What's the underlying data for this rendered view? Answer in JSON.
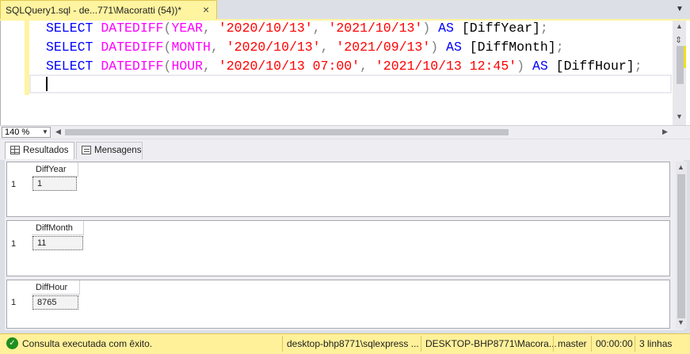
{
  "document_tab": {
    "title": "SQLQuery1.sql - de...771\\Macoratti (54))*",
    "close_glyph": "×"
  },
  "editor": {
    "lines": [
      [
        {
          "t": "SELECT ",
          "c": "kw"
        },
        {
          "t": "DATEDIFF",
          "c": "fn"
        },
        {
          "t": "(",
          "c": "gray"
        },
        {
          "t": "YEAR",
          "c": "fn"
        },
        {
          "t": ", ",
          "c": "gray"
        },
        {
          "t": "'2020/10/13'",
          "c": "str"
        },
        {
          "t": ", ",
          "c": "gray"
        },
        {
          "t": "'2021/10/13'",
          "c": "str"
        },
        {
          "t": ") ",
          "c": "gray"
        },
        {
          "t": "AS ",
          "c": "kw"
        },
        {
          "t": "[DiffYear]",
          "c": "plain"
        },
        {
          "t": ";",
          "c": "gray"
        }
      ],
      [
        {
          "t": "SELECT ",
          "c": "kw"
        },
        {
          "t": "DATEDIFF",
          "c": "fn"
        },
        {
          "t": "(",
          "c": "gray"
        },
        {
          "t": "MONTH",
          "c": "fn"
        },
        {
          "t": ", ",
          "c": "gray"
        },
        {
          "t": "'2020/10/13'",
          "c": "str"
        },
        {
          "t": ", ",
          "c": "gray"
        },
        {
          "t": "'2021/09/13'",
          "c": "str"
        },
        {
          "t": ") ",
          "c": "gray"
        },
        {
          "t": "AS ",
          "c": "kw"
        },
        {
          "t": "[DiffMonth]",
          "c": "plain"
        },
        {
          "t": ";",
          "c": "gray"
        }
      ],
      [
        {
          "t": "SELECT ",
          "c": "kw"
        },
        {
          "t": "DATEDIFF",
          "c": "fn"
        },
        {
          "t": "(",
          "c": "gray"
        },
        {
          "t": "HOUR",
          "c": "fn"
        },
        {
          "t": ", ",
          "c": "gray"
        },
        {
          "t": "'2020/10/13 07:00'",
          "c": "str"
        },
        {
          "t": ", ",
          "c": "gray"
        },
        {
          "t": "'2021/10/13 12:45'",
          "c": "str"
        },
        {
          "t": ") ",
          "c": "gray"
        },
        {
          "t": "AS ",
          "c": "kw"
        },
        {
          "t": "[DiffHour]",
          "c": "plain"
        },
        {
          "t": ";",
          "c": "gray"
        }
      ]
    ],
    "zoom": "140 %"
  },
  "results_tabs": {
    "results": "Resultados",
    "messages": "Mensagens"
  },
  "grids": [
    {
      "column": "DiffYear",
      "row_number": "1",
      "value": "1"
    },
    {
      "column": "DiffMonth",
      "row_number": "1",
      "value": "11"
    },
    {
      "column": "DiffHour",
      "row_number": "1",
      "value": "8765"
    }
  ],
  "status_bar": {
    "message": "Consulta executada com êxito.",
    "server": "desktop-bhp8771\\sqlexpress ...",
    "login": "DESKTOP-BHP8771\\Macora...",
    "database": "master",
    "elapsed": "00:00:00",
    "rows": "3 linhas"
  },
  "colors": {
    "keyword": "#0000ff",
    "function": "#ff00ff",
    "string": "#ff0000",
    "operator": "#808080",
    "status_bar_bg": "#fff19a",
    "tab_active_bg": "#fff4a0"
  },
  "icons": [
    "close-icon",
    "dropdown-arrow-icon",
    "results-grid-icon",
    "messages-icon",
    "success-check-icon"
  ]
}
